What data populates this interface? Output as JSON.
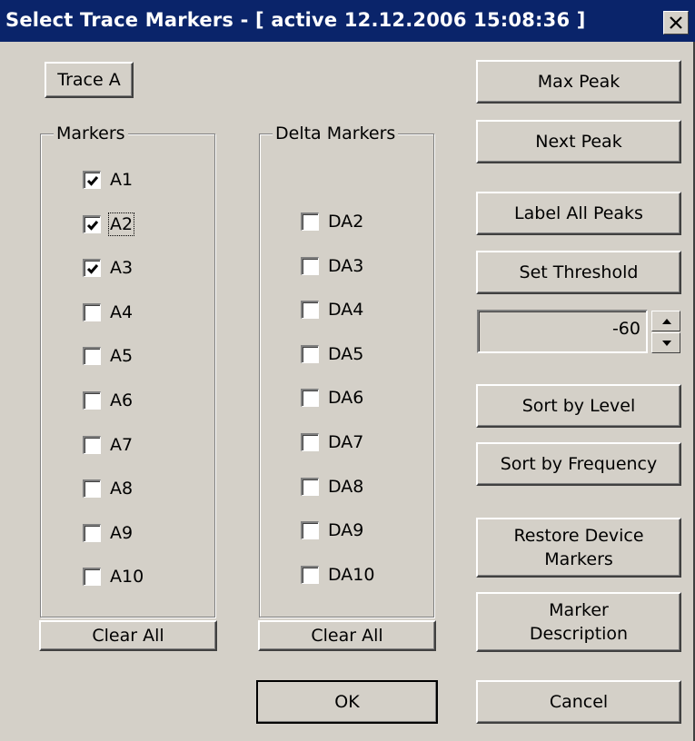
{
  "title": "Select Trace Markers - [ active 12.12.2006  15:08:36 ]",
  "trace_button": "Trace A",
  "markers": {
    "label": "Markers",
    "items": [
      {
        "label": "A1",
        "checked": true
      },
      {
        "label": "A2",
        "checked": true
      },
      {
        "label": "A3",
        "checked": true
      },
      {
        "label": "A4",
        "checked": false
      },
      {
        "label": "A5",
        "checked": false
      },
      {
        "label": "A6",
        "checked": false
      },
      {
        "label": "A7",
        "checked": false
      },
      {
        "label": "A8",
        "checked": false
      },
      {
        "label": "A9",
        "checked": false
      },
      {
        "label": "A10",
        "checked": false
      }
    ],
    "clear_label": "Clear All"
  },
  "delta_markers": {
    "label": "Delta Markers",
    "items": [
      {
        "label": "DA2",
        "checked": false
      },
      {
        "label": "DA3",
        "checked": false
      },
      {
        "label": "DA4",
        "checked": false
      },
      {
        "label": "DA5",
        "checked": false
      },
      {
        "label": "DA6",
        "checked": false
      },
      {
        "label": "DA7",
        "checked": false
      },
      {
        "label": "DA8",
        "checked": false
      },
      {
        "label": "DA9",
        "checked": false
      },
      {
        "label": "DA10",
        "checked": false
      }
    ],
    "clear_label": "Clear All"
  },
  "actions": {
    "max_peak": "Max Peak",
    "next_peak": "Next Peak",
    "label_all_peaks": "Label All Peaks",
    "set_threshold": "Set Threshold",
    "threshold_value": "-60",
    "sort_by_level": "Sort by Level",
    "sort_by_frequency": "Sort by Frequency",
    "restore_line1": "Restore Device",
    "restore_line2": "Markers",
    "description_line1": "Marker",
    "description_line2": "Description"
  },
  "ok_label": "OK",
  "cancel_label": "Cancel",
  "icons": {
    "close": "close-icon",
    "check": "checkmark-icon",
    "up": "arrow-up-icon",
    "down": "arrow-down-icon"
  },
  "colors": {
    "titlebar": "#0a246a",
    "face": "#d4d0c8"
  }
}
